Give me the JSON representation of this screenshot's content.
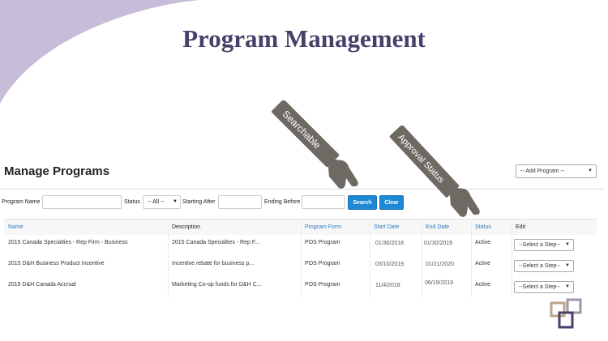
{
  "header": {
    "title": "Program Management"
  },
  "section": {
    "title": "Manage Programs",
    "add_program_label": "-- Add Program --"
  },
  "filters": {
    "program_name_label": "Program Name",
    "status_label": "Status",
    "status_value": "-- All --",
    "starting_after_label": "Starting After",
    "ending_before_label": "Ending Before",
    "search_label": "Search",
    "clear_label": "Clear"
  },
  "callouts": {
    "searchable": "Searchable",
    "approval_status": "Approval Status"
  },
  "table": {
    "headers": {
      "name": "Name",
      "description": "Description",
      "program_form": "Program Form",
      "start_date": "Start Date",
      "end_date": "End Date",
      "status": "Status",
      "edit": "Edit"
    },
    "rows": [
      {
        "name": "2015 Canada Specialties - Rep Firm - Business",
        "description": "2015 Canada Specialties - Rep F...",
        "program_form": "POS Program",
        "start_date": "01/30/2018",
        "end_date": "01/30/2019",
        "status": "Active",
        "edit": "--Select a Step--"
      },
      {
        "name": "2015 D&H Business Product Incentive",
        "description": "Incentive rebate for business p...",
        "program_form": "POS Program",
        "start_date": "03/10/2019",
        "end_date": "01/21/2020",
        "status": "Active",
        "edit": "--Select a Step--"
      },
      {
        "name": "2015 D&H Canada Accrual",
        "description": "Marketing Co-op funds for D&H C...",
        "program_form": "POS Program",
        "start_date": "11/4/2018",
        "end_date": "06/19/2019",
        "status": "Active",
        "edit": "--Select a Step--"
      }
    ]
  },
  "colors": {
    "title": "#4a3f6b",
    "swoosh": "#c8bdd8",
    "button": "#1e88d4",
    "link": "#2a7cc7",
    "callout": "#6f6963"
  },
  "icons": {
    "dropdown": "caret-down-icon",
    "logo": "logo-icon",
    "hand": "pointing-hand-icon"
  }
}
